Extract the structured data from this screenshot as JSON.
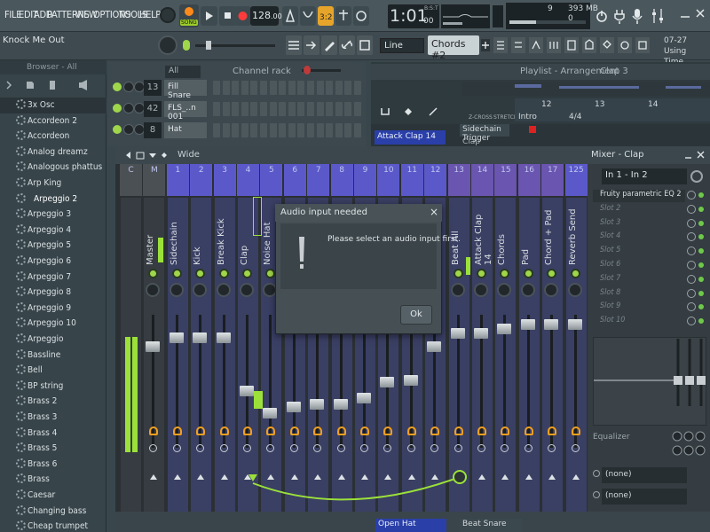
{
  "menu": {
    "file": "FILE",
    "edit": "EDIT",
    "add": "ADD",
    "patterns": "PATTERNS",
    "view": "VIEW",
    "options": "OPTIONS",
    "tools": "TOOLS",
    "help": "HELP"
  },
  "transport": {
    "mode": "SONG",
    "tempo": "128",
    "tempo_decimal": ".000",
    "time": "1:01",
    "time_sub": "00",
    "time_unit": "B:S:T"
  },
  "stats": {
    "cpu": "9",
    "memory": "393 MB",
    "memory_sub": "0"
  },
  "hint": {
    "text": "Knock Me Out"
  },
  "toolbar2": {
    "line": "Line",
    "chords": "Chords #2",
    "signature_date": "07-27",
    "signature_1": "Using",
    "signature_2": "Time Signatures"
  },
  "browser": {
    "title": "Browser - All",
    "items": [
      "3x Osc",
      "Accordeon 2",
      "Accordeon",
      "Analog dreamz",
      "Analogous phattus",
      "Arp King",
      "Arpeggio 2",
      "Arpeggio 3",
      "Arpeggio 4",
      "Arpeggio 5",
      "Arpeggio 6",
      "Arpeggio 7",
      "Arpeggio 8",
      "Arpeggio 9",
      "Arpeggio 10",
      "Arpeggio",
      "Bassline",
      "Bell",
      "BP string",
      "Brass 2",
      "Brass 3",
      "Brass 4",
      "Brass 5",
      "Brass 6",
      "Brass",
      "Caesar",
      "Changing bass",
      "Cheap trumpet"
    ]
  },
  "rack": {
    "filter": "All",
    "title": "Channel rack",
    "channels": [
      {
        "num": "13",
        "name": "Fill Snare"
      },
      {
        "num": "42",
        "name": "FLS_..n 001"
      },
      {
        "num": "8",
        "name": "Hat"
      }
    ]
  },
  "playlist": {
    "title": "Playlist - Arrangement",
    "pattern": "Clap 3",
    "intro": "Intro",
    "ruler": [
      "12",
      "13",
      "14"
    ],
    "meter": "4/4",
    "zcross": "Z-CROSS",
    "stretch": "STRETCH",
    "clip_attack": "Attack Clap 14",
    "clip_sidechain": "Sidechain Trigger",
    "clip_clap": "Clap"
  },
  "mixer": {
    "title": "Mixer - Clap",
    "mode": "Wide",
    "input": "In 1 - In 2",
    "slots": [
      "Fruity parametric EQ 2",
      "Slot 2",
      "Slot 3",
      "Slot 4",
      "Slot 5",
      "Slot 6",
      "Slot 7",
      "Slot 8",
      "Slot 9",
      "Slot 10"
    ],
    "equalizer": "Equalizer",
    "out1": "(none)",
    "out2": "(none)",
    "tracks": [
      {
        "num": "C",
        "name": ""
      },
      {
        "num": "M",
        "name": "Master"
      },
      {
        "num": "1",
        "name": "Sidechain"
      },
      {
        "num": "2",
        "name": "Kick"
      },
      {
        "num": "3",
        "name": "Break Kick"
      },
      {
        "num": "4",
        "name": "Clap"
      },
      {
        "num": "5",
        "name": "Noise Hat"
      },
      {
        "num": "6",
        "name": ""
      },
      {
        "num": "7",
        "name": ""
      },
      {
        "num": "8",
        "name": ""
      },
      {
        "num": "9",
        "name": ""
      },
      {
        "num": "10",
        "name": ""
      },
      {
        "num": "11",
        "name": ""
      },
      {
        "num": "12",
        "name": ""
      },
      {
        "num": "13",
        "name": "Beat All"
      },
      {
        "num": "14",
        "name": "Attack Clap 14"
      },
      {
        "num": "15",
        "name": "Chords"
      },
      {
        "num": "16",
        "name": "Pad"
      },
      {
        "num": "17",
        "name": "Chord + Pad"
      },
      {
        "num": "125",
        "name": "Reverb Send"
      }
    ]
  },
  "dialog": {
    "title": "Audio input needed",
    "message": "Please select an audio input first.",
    "ok": "Ok",
    "close": "×"
  },
  "bottom": {
    "open_hat": "Open Hat",
    "beat_snare": "Beat Snare"
  },
  "colors": {
    "accent_green": "#9ccc2a",
    "record_red": "#ff3b3b",
    "track_blue": "#5b59c9",
    "clip_blue": "#2a3fa8"
  }
}
